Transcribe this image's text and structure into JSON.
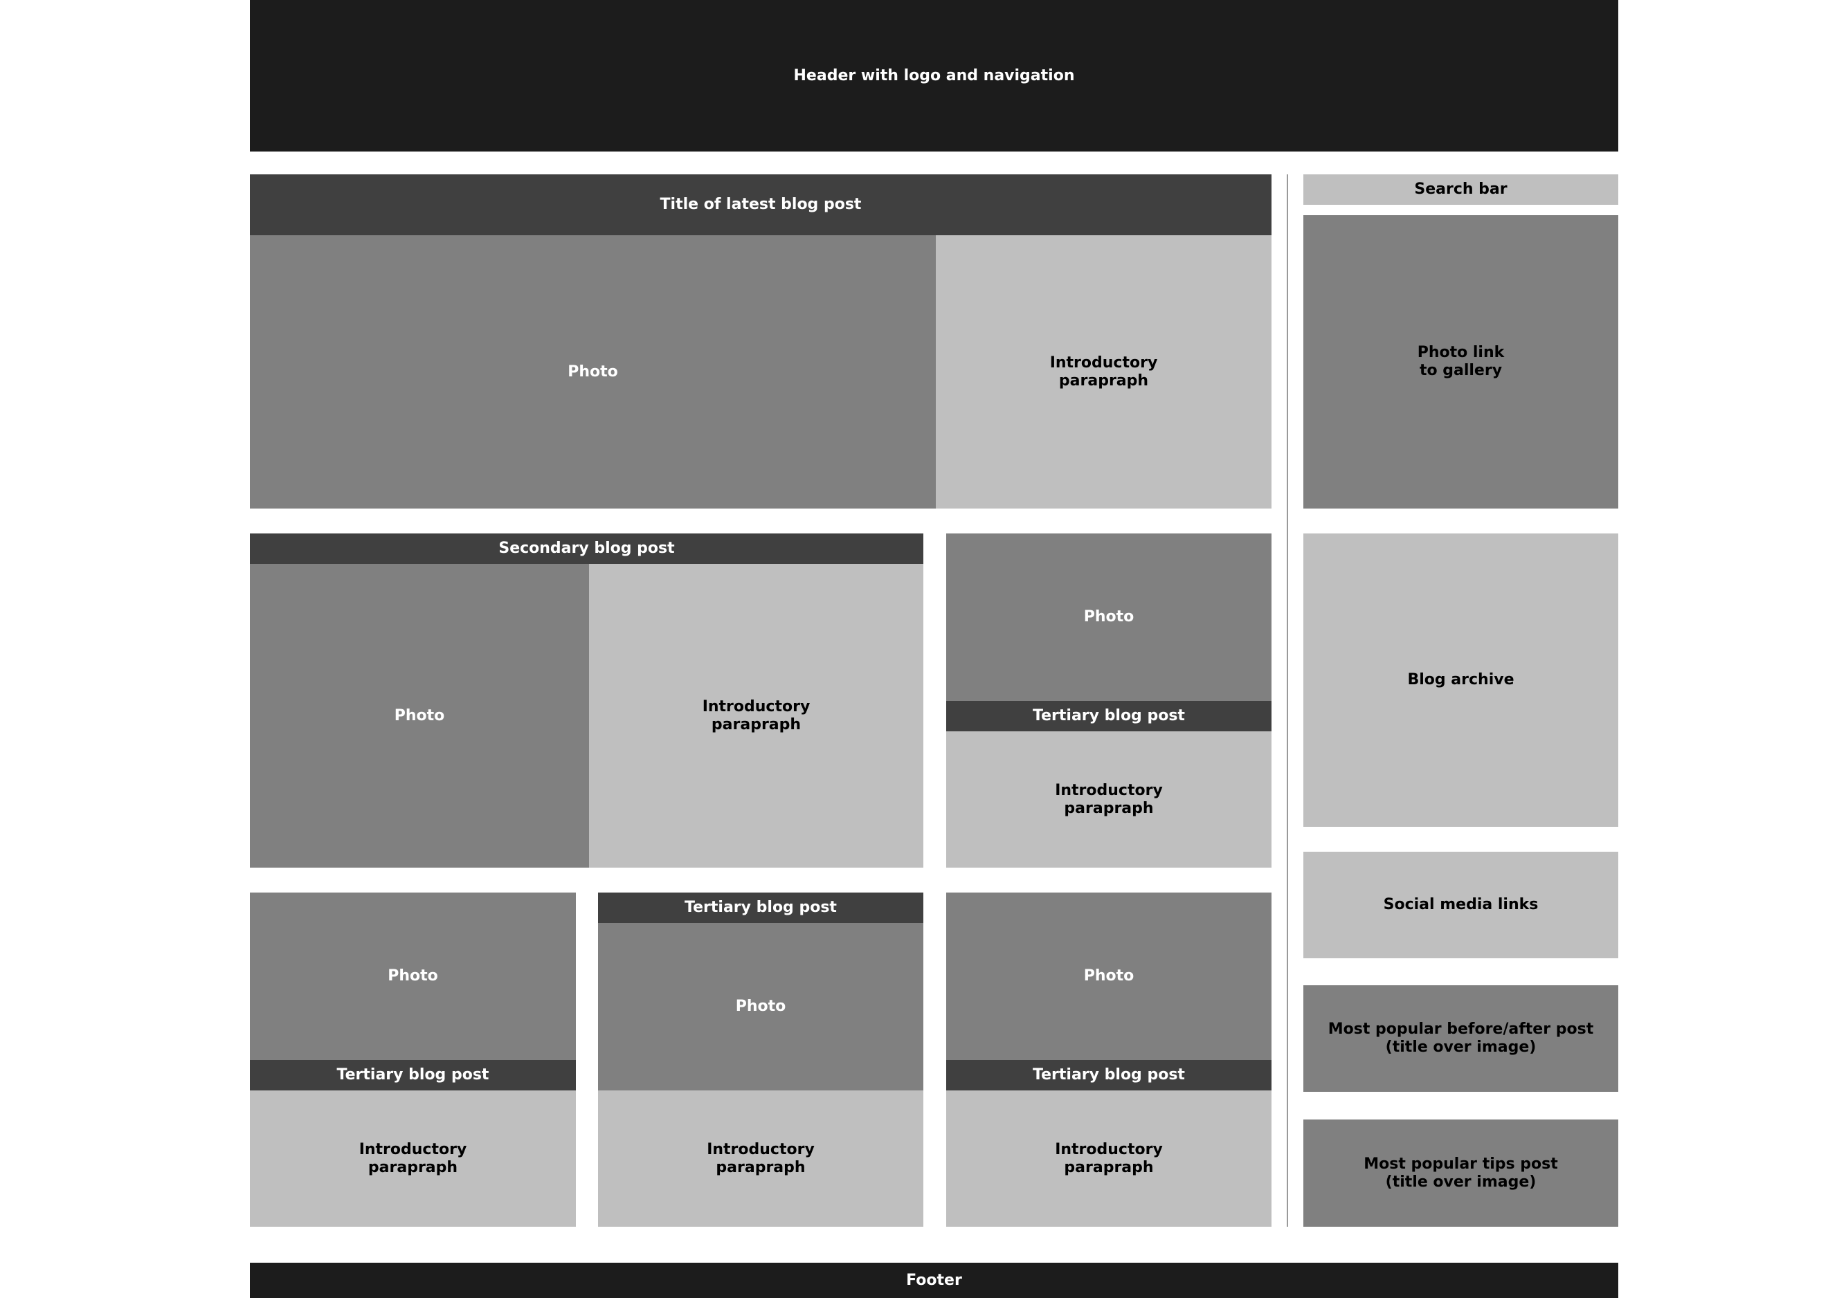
{
  "header": {
    "label": "Header with logo and navigation"
  },
  "main_post": {
    "title": "Title of latest blog post",
    "photo": "Photo",
    "intro": "Introductory\nparapraph"
  },
  "secondary_post": {
    "title": "Secondary blog post",
    "photo": "Photo",
    "intro": "Introductory\nparapraph"
  },
  "tertiary_posts": [
    {
      "title": "Tertiary blog post",
      "photo": "Photo",
      "intro": "Introductory\nparapraph"
    },
    {
      "title": "Tertiary blog post",
      "photo": "Photo",
      "intro": "Introductory\nparapraph"
    },
    {
      "title": "Tertiary blog post",
      "photo": "Photo",
      "intro": "Introductory\nparapraph"
    },
    {
      "title": "Tertiary blog post",
      "photo": "Photo",
      "intro": "Introductory\nparapraph"
    }
  ],
  "sidebar": {
    "search": "Search bar",
    "gallery": "Photo link\nto gallery",
    "archive": "Blog archive",
    "social": "Social media links",
    "popular_before_after": "Most popular before/after post\n(title over image)",
    "popular_tips": "Most popular tips post\n(title over image)"
  },
  "footer": {
    "label": "Footer"
  },
  "colors": {
    "black": "#1c1c1c",
    "dark": "#404040",
    "mid": "#808080",
    "light": "#bfbfbf"
  }
}
